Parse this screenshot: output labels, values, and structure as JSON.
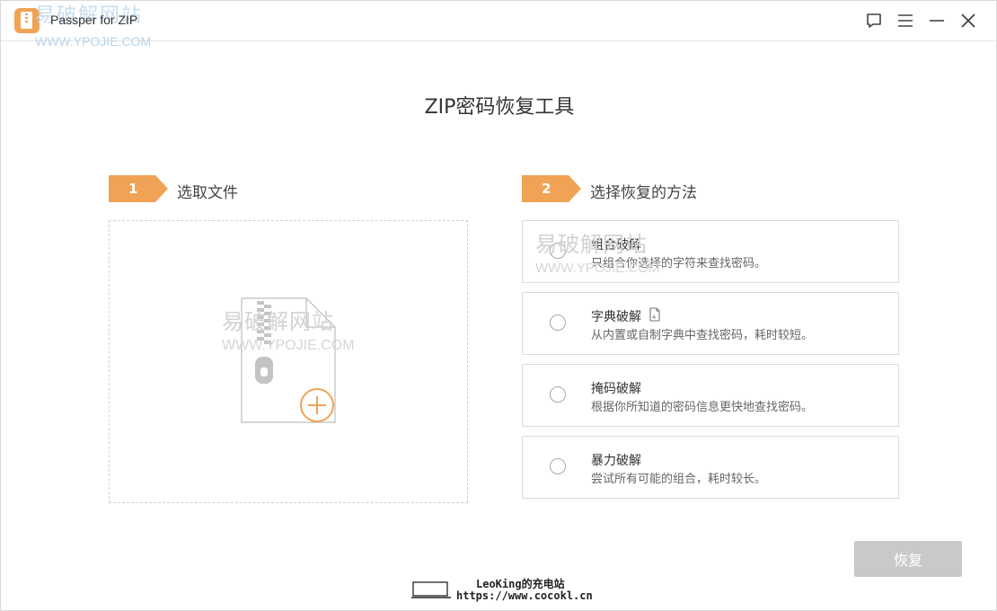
{
  "app": {
    "title": "Passper for ZIP",
    "watermark_cn": "易破解网站",
    "watermark_url": "WWW.YPOJIE.COM"
  },
  "window_controls": {
    "feedback_icon": "chat-bubble-icon",
    "menu_icon": "hamburger-menu-icon",
    "minimize_icon": "minimize-icon",
    "close_icon": "close-icon"
  },
  "page_title": "ZIP密码恢复工具",
  "step1": {
    "number": "1",
    "label": "选取文件"
  },
  "step2": {
    "number": "2",
    "label": "选择恢复的方法"
  },
  "dropzone": {
    "watermark_cn": "易破解网站",
    "watermark_url": "WWW.YPOJIE.COM"
  },
  "methods": [
    {
      "title": "组合破解",
      "desc": "只组合你选择的字符来查找密码。",
      "selected": false
    },
    {
      "title": "字典破解",
      "desc": "从内置或自制字典中查找密码，耗时较短。",
      "selected": false
    },
    {
      "title": "掩码破解",
      "desc": "根据你所知道的密码信息更快地查找密码。",
      "selected": false
    },
    {
      "title": "暴力破解",
      "desc": "尝试所有可能的组合，耗时较长。",
      "selected": false
    }
  ],
  "method_watermark": {
    "cn": "易破解网站",
    "url": "WWW.YPOJIE.COM"
  },
  "recover_button": {
    "label": "恢复",
    "enabled": false
  },
  "footer_watermark": {
    "line1": "LeoKing的充电站",
    "line2": "https://www.cocokl.cn"
  },
  "colors": {
    "accent": "#f0a355",
    "disabled_button": "#c9c9c9"
  }
}
